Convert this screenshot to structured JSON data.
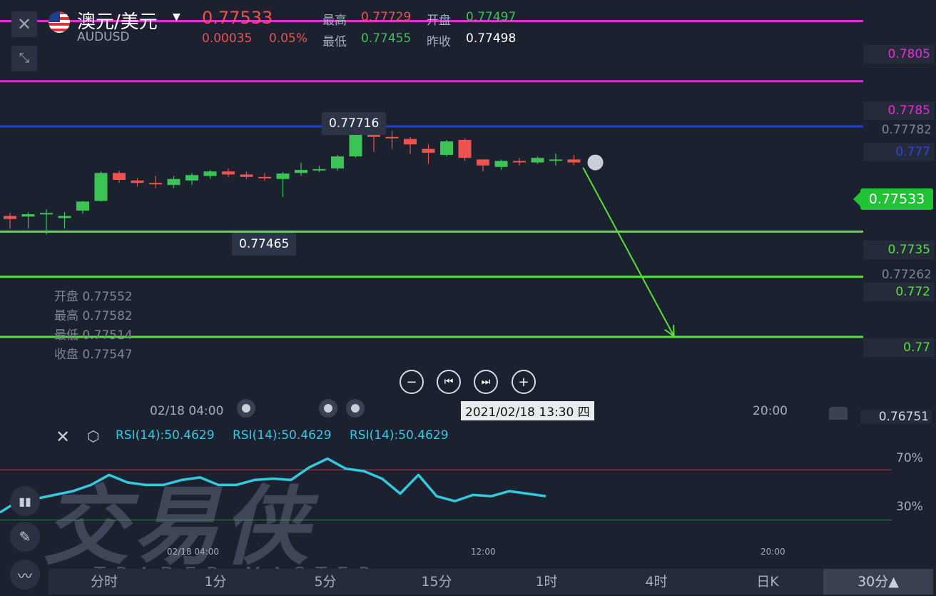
{
  "header": {
    "close_icon": "close-icon",
    "symbol_name": "澳元/美元",
    "symbol_code": "AUDUSD",
    "price": "0.77533",
    "change": "0.00035",
    "change_pct": "0.05%",
    "high_label": "最高",
    "high_value": "0.77729",
    "open_label": "开盘",
    "open_value": "0.77497",
    "low_label": "最低",
    "low_value": "0.77455",
    "prev_close_label": "昨收",
    "prev_close_value": "0.77498"
  },
  "chart_data": {
    "type": "candlestick",
    "title": "澳元/美元 AUDUSD",
    "x_start_label": "02/18 04:00",
    "x_end_label": "20:00",
    "crosshair_label": "2021/02/18 13:30 四",
    "ylim": [
      0.7672,
      0.7812
    ],
    "candles": [
      [
        0.77402,
        0.77412,
        0.7736,
        0.77392
      ],
      [
        0.774,
        0.77415,
        0.7736,
        0.77408
      ],
      [
        0.7741,
        0.77425,
        0.7734,
        0.77412
      ],
      [
        0.77395,
        0.77415,
        0.7736,
        0.77402
      ],
      [
        0.7742,
        0.77452,
        0.7741,
        0.7745
      ],
      [
        0.77452,
        0.7755,
        0.7745,
        0.77545
      ],
      [
        0.77545,
        0.77552,
        0.77512,
        0.77522
      ],
      [
        0.7752,
        0.77528,
        0.775,
        0.77512
      ],
      [
        0.77512,
        0.77535,
        0.77495,
        0.7751
      ],
      [
        0.77505,
        0.77535,
        0.77495,
        0.77525
      ],
      [
        0.7752,
        0.77545,
        0.77505,
        0.77538
      ],
      [
        0.77535,
        0.77555,
        0.77525,
        0.7755
      ],
      [
        0.7755,
        0.7756,
        0.7753,
        0.7754
      ],
      [
        0.7754,
        0.7755,
        0.77525,
        0.77532
      ],
      [
        0.77532,
        0.77545,
        0.7752,
        0.7753
      ],
      [
        0.77525,
        0.77548,
        0.77465,
        0.77543
      ],
      [
        0.77545,
        0.77578,
        0.77535,
        0.77555
      ],
      [
        0.77555,
        0.7757,
        0.77548,
        0.77558
      ],
      [
        0.7756,
        0.77605,
        0.77552,
        0.776
      ],
      [
        0.776,
        0.7769,
        0.77595,
        0.7768
      ],
      [
        0.7768,
        0.77716,
        0.77615,
        0.77665
      ],
      [
        0.77665,
        0.77685,
        0.77625,
        0.7766
      ],
      [
        0.77658,
        0.77665,
        0.77608,
        0.7764
      ],
      [
        0.77625,
        0.7764,
        0.77575,
        0.77612
      ],
      [
        0.77605,
        0.77655,
        0.776,
        0.7765
      ],
      [
        0.77655,
        0.7766,
        0.77585,
        0.77595
      ],
      [
        0.7759,
        0.7759,
        0.7755,
        0.7757
      ],
      [
        0.77565,
        0.7759,
        0.77555,
        0.77585
      ],
      [
        0.77585,
        0.77595,
        0.7757,
        0.7758
      ],
      [
        0.7758,
        0.776,
        0.77575,
        0.77595
      ],
      [
        0.7759,
        0.7761,
        0.7757,
        0.7759
      ],
      [
        0.7759,
        0.77605,
        0.7757,
        0.7758
      ]
    ],
    "horizontal_lines": [
      {
        "value": 0.7805,
        "label": "0.7805",
        "color": "#e92ad8"
      },
      {
        "value": 0.7785,
        "label": "0.7785",
        "color": "#e92ad8"
      },
      {
        "value": 0.777,
        "label": "0.777",
        "color": "#1f3fd9"
      },
      {
        "value": 0.7735,
        "label": "0.7735",
        "color": "#58e03a"
      },
      {
        "value": 0.772,
        "label": "0.772",
        "color": "#58e03a"
      },
      {
        "value": 0.77,
        "label": "0.77",
        "color": "#58e03a"
      }
    ],
    "extra_axis_labels": [
      "0.77782",
      "0.77262",
      "0.76751"
    ],
    "max_marker": "0.77716",
    "min_marker": "0.77465",
    "hover_ohlc": {
      "open_label": "开盘",
      "open": "0.77552",
      "high_label": "最高",
      "high": "0.77582",
      "low_label": "最低",
      "low": "0.77514",
      "close_label": "收盘",
      "close": "0.77547"
    },
    "arrow": {
      "from": [
        31.5,
        0.77563
      ],
      "to": [
        36.5,
        0.77002
      ],
      "color": "#58e03a"
    }
  },
  "rsi": {
    "label1": "RSI(14):50.4629",
    "label2": "RSI(14):50.4629",
    "label3": "RSI(14):50.4629",
    "level_high": "70%",
    "level_low": "30%",
    "values": [
      36,
      45,
      47,
      50,
      53,
      58,
      66,
      60,
      58,
      58,
      62,
      64,
      58,
      58,
      62,
      63,
      62,
      72,
      79,
      71,
      69,
      63,
      51,
      66,
      49,
      45,
      50,
      49,
      53,
      51,
      49
    ],
    "line_color": "#35c9e0",
    "axis_start": "02/18 04:00",
    "axis_mid": "12:00",
    "axis_end": "20:00"
  },
  "watermark": {
    "cn": "交易侠",
    "en": "TRADER MASTER"
  },
  "timeframes": [
    "分时",
    "1分",
    "5分",
    "15分",
    "1时",
    "4时",
    "日K",
    "30分▲"
  ]
}
